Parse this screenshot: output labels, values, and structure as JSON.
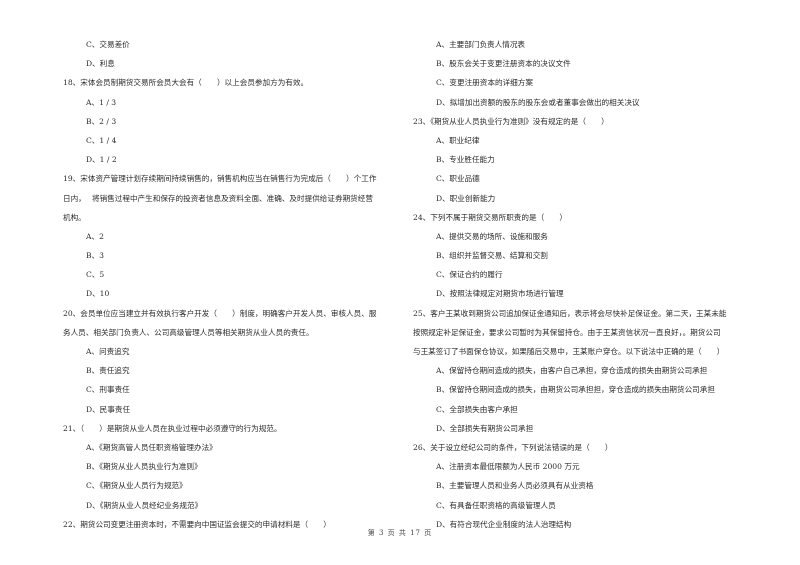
{
  "page": {
    "footer": "第 3 页 共 17 页"
  },
  "left_column": [
    {
      "type": "opt",
      "text": "C、交易差价"
    },
    {
      "type": "opt",
      "text": "D、利息"
    },
    {
      "type": "q",
      "text": "18、宋体会员制期货交易所会员大会有（　　）以上会员参加方为有效。"
    },
    {
      "type": "opt",
      "text": "A、1 / 3"
    },
    {
      "type": "opt",
      "text": "B、2 / 3"
    },
    {
      "type": "opt",
      "text": "C、1 / 4"
    },
    {
      "type": "opt",
      "text": "D、1 / 2"
    },
    {
      "type": "q",
      "text": "19、宋体资产管理计划存续期间持续销售的，销售机构应当在销售行为完成后（　　）个工作"
    },
    {
      "type": "cont",
      "text": "日内，　 将销售过程中产生和保存的投资者信息及资料全面、准确、及时提供给证券期货经营"
    },
    {
      "type": "cont",
      "text": "机构。"
    },
    {
      "type": "opt",
      "text": "A、2"
    },
    {
      "type": "opt",
      "text": "B、3"
    },
    {
      "type": "opt",
      "text": "C、5"
    },
    {
      "type": "opt",
      "text": "D、10"
    },
    {
      "type": "q",
      "text": "20、会员单位应当建立并有效执行客户开发（　　）制度，明确客户开发人员、审核人员、服"
    },
    {
      "type": "cont",
      "text": "务人员、相关部门负责人、公司高级管理人员等相关期货从业人员的责任。"
    },
    {
      "type": "opt",
      "text": "A、问责追究"
    },
    {
      "type": "opt",
      "text": "B、责任追究"
    },
    {
      "type": "opt",
      "text": "C、刑事责任"
    },
    {
      "type": "opt",
      "text": "D、民事责任"
    },
    {
      "type": "q",
      "text": "21、（　　）是期货从业人员在执业过程中必须遵守的行为规范。"
    },
    {
      "type": "opt",
      "text": "A、《期货高管人员任职资格管理办法》"
    },
    {
      "type": "opt",
      "text": "B、《期货从业人员执业行为准则》"
    },
    {
      "type": "opt",
      "text": "C、《期货从业人员行为规范》"
    },
    {
      "type": "opt",
      "text": "D、《期货从业人员经纪业务规范》"
    },
    {
      "type": "q",
      "text": "22、期货公司变更注册资本时，不需要向中国证监会提交的申请材料是（　　）"
    }
  ],
  "right_column": [
    {
      "type": "opt",
      "text": "A、主要部门负责人情况表"
    },
    {
      "type": "opt",
      "text": "B、股东会关于变更注册资本的决议文件"
    },
    {
      "type": "opt",
      "text": "C、变更注册资本的详细方案"
    },
    {
      "type": "opt",
      "text": "D、拟增加出资额的股东的股东会或者董事会做出的相关决议"
    },
    {
      "type": "q",
      "text": "23、《期货从业人员执业行为准则》没有规定的是（　　）"
    },
    {
      "type": "opt",
      "text": "A、职业纪律"
    },
    {
      "type": "opt",
      "text": "B、专业胜任能力"
    },
    {
      "type": "opt",
      "text": "C、职业品德"
    },
    {
      "type": "opt",
      "text": "D、职业创新能力"
    },
    {
      "type": "q",
      "text": "24、下列不属于期货交易所职责的是（　　）"
    },
    {
      "type": "opt",
      "text": "A、提供交易的场所、设施和服务"
    },
    {
      "type": "opt",
      "text": "B、组织并监督交易、结算和交割"
    },
    {
      "type": "opt",
      "text": "C、保证合约的履行"
    },
    {
      "type": "opt",
      "text": "D、按照法律规定对期货市场进行管理"
    },
    {
      "type": "q",
      "text": "25、客户王某收到期货公司追加保证金通知后，表示将会尽快补足保证金。第二天，王某未能"
    },
    {
      "type": "cont",
      "text": "按照规定补足保证金，要求公司暂时为其保留持仓。由于王某资信状况一直良好，。期货公司"
    },
    {
      "type": "cont",
      "text": "与王某签订了书面保仓协议，如果随后交易中，王某账户穿仓。以下说法中正确的是（　　）"
    },
    {
      "type": "opt",
      "text": "A、保留持仓期间造成的损失，由客户自己承担，穿仓造成的损失由期货公司承担"
    },
    {
      "type": "opt",
      "text": "B、保留持仓期间造成的损失，由期货公司承担担，穿仓造成的损失由期货公司承担"
    },
    {
      "type": "opt",
      "text": "C、全部损失由客户承担"
    },
    {
      "type": "opt",
      "text": "D、全部损失有期货公司承担"
    },
    {
      "type": "q",
      "text": "26、关于设立经纪公司的条件，下列说法错误的是（　　）"
    },
    {
      "type": "opt",
      "text": "A、注册资本最低限额为人民币 2000 万元"
    },
    {
      "type": "opt",
      "text": "B、主要管理人员和业务人员必须具有从业资格"
    },
    {
      "type": "opt",
      "text": "C、有具备任职资格的高级管理人员"
    },
    {
      "type": "opt",
      "text": "D、有符合现代企业制度的法人治理结构"
    }
  ]
}
